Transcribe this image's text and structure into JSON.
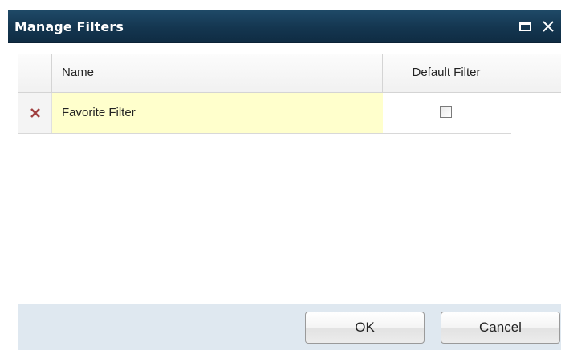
{
  "dialog": {
    "title": "Manage Filters",
    "maximize_icon": "maximize-icon",
    "close_icon": "close-icon"
  },
  "grid": {
    "columns": [
      {
        "key": "select",
        "label": ""
      },
      {
        "key": "name",
        "label": "Name"
      },
      {
        "key": "default",
        "label": "Default Filter"
      }
    ],
    "rows": [
      {
        "delete_icon": "delete-icon",
        "name": "Favorite Filter",
        "default_checked": false
      }
    ]
  },
  "buttons": {
    "ok_label": "OK",
    "cancel_label": "Cancel"
  },
  "colors": {
    "titlebar": "#143650",
    "selected_cell": "#ffffcc",
    "footer": "#dfe8f0",
    "delete_icon": "#a04040"
  }
}
